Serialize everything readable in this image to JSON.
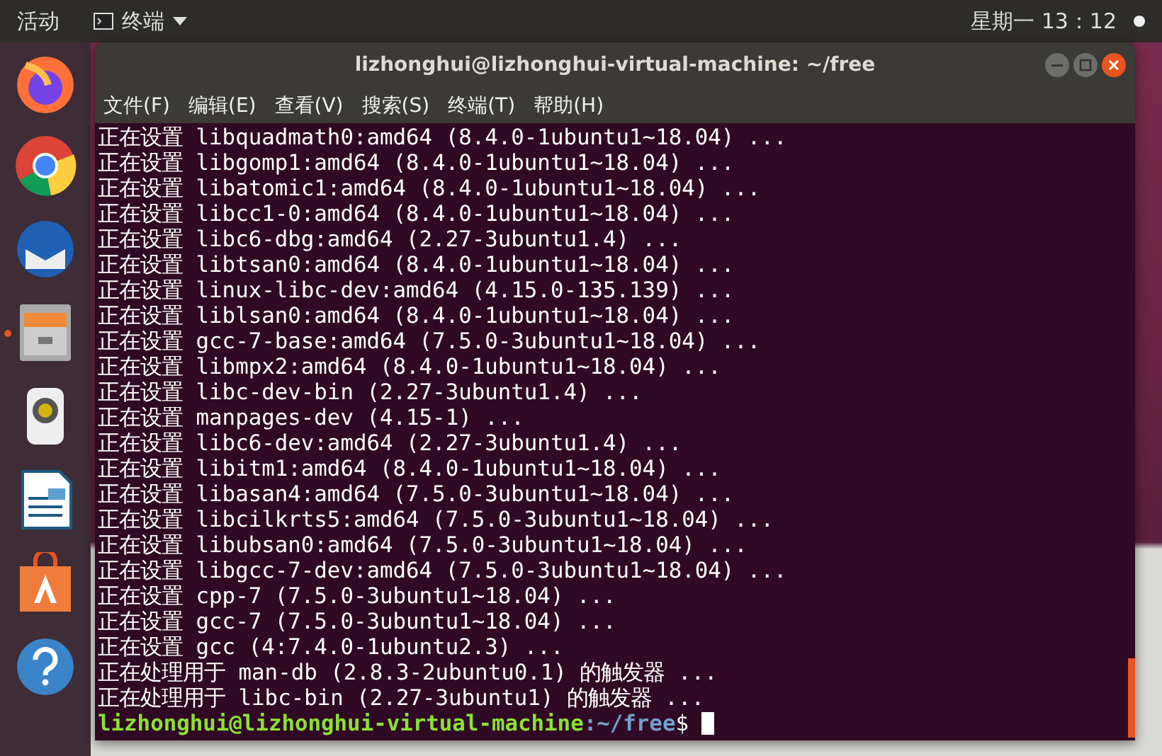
{
  "top_bar": {
    "activities": "活动",
    "app_menu": "终端",
    "clock": "星期一 13：12"
  },
  "dock": {
    "items": [
      {
        "kind": "globe",
        "running": false
      },
      {
        "kind": "chrome",
        "running": false
      },
      {
        "kind": "mail",
        "running": false
      },
      {
        "kind": "cabinet",
        "running": true
      },
      {
        "kind": "speaker",
        "running": false
      },
      {
        "kind": "document",
        "running": false
      },
      {
        "kind": "bag",
        "running": false
      },
      {
        "kind": "help",
        "running": false
      }
    ]
  },
  "window": {
    "title": "lizhonghui@lizhonghui-virtual-machine: ~/free",
    "menu": [
      "文件(F)",
      "编辑(E)",
      "查看(V)",
      "搜索(S)",
      "终端(T)",
      "帮助(H)"
    ],
    "lines": [
      {
        "kind": "output",
        "prefix": "正在设置",
        "text": "libquadmath0:amd64 (8.4.0-1ubuntu1~18.04) ..."
      },
      {
        "kind": "output",
        "prefix": "正在设置",
        "text": "libgomp1:amd64 (8.4.0-1ubuntu1~18.04) ..."
      },
      {
        "kind": "output",
        "prefix": "正在设置",
        "text": "libatomic1:amd64 (8.4.0-1ubuntu1~18.04) ..."
      },
      {
        "kind": "output",
        "prefix": "正在设置",
        "text": "libcc1-0:amd64 (8.4.0-1ubuntu1~18.04) ..."
      },
      {
        "kind": "output",
        "prefix": "正在设置",
        "text": "libc6-dbg:amd64 (2.27-3ubuntu1.4) ..."
      },
      {
        "kind": "output",
        "prefix": "正在设置",
        "text": "libtsan0:amd64 (8.4.0-1ubuntu1~18.04) ..."
      },
      {
        "kind": "output",
        "prefix": "正在设置",
        "text": "linux-libc-dev:amd64 (4.15.0-135.139) ..."
      },
      {
        "kind": "output",
        "prefix": "正在设置",
        "text": "liblsan0:amd64 (8.4.0-1ubuntu1~18.04) ..."
      },
      {
        "kind": "output",
        "prefix": "正在设置",
        "text": "gcc-7-base:amd64 (7.5.0-3ubuntu1~18.04) ..."
      },
      {
        "kind": "output",
        "prefix": "正在设置",
        "text": "libmpx2:amd64 (8.4.0-1ubuntu1~18.04) ..."
      },
      {
        "kind": "output",
        "prefix": "正在设置",
        "text": "libc-dev-bin (2.27-3ubuntu1.4) ..."
      },
      {
        "kind": "output",
        "prefix": "正在设置",
        "text": "manpages-dev (4.15-1) ..."
      },
      {
        "kind": "output",
        "prefix": "正在设置",
        "text": "libc6-dev:amd64 (2.27-3ubuntu1.4) ..."
      },
      {
        "kind": "output",
        "prefix": "正在设置",
        "text": "libitm1:amd64 (8.4.0-1ubuntu1~18.04) ..."
      },
      {
        "kind": "output",
        "prefix": "正在设置",
        "text": "libasan4:amd64 (7.5.0-3ubuntu1~18.04) ..."
      },
      {
        "kind": "output",
        "prefix": "正在设置",
        "text": "libcilkrts5:amd64 (7.5.0-3ubuntu1~18.04) ..."
      },
      {
        "kind": "output",
        "prefix": "正在设置",
        "text": "libubsan0:amd64 (7.5.0-3ubuntu1~18.04) ..."
      },
      {
        "kind": "output",
        "prefix": "正在设置",
        "text": "libgcc-7-dev:amd64 (7.5.0-3ubuntu1~18.04) ..."
      },
      {
        "kind": "output",
        "prefix": "正在设置",
        "text": "cpp-7 (7.5.0-3ubuntu1~18.04) ..."
      },
      {
        "kind": "output",
        "prefix": "正在设置",
        "text": "gcc-7 (7.5.0-3ubuntu1~18.04) ..."
      },
      {
        "kind": "output",
        "prefix": "正在设置",
        "text": "gcc (4:7.4.0-1ubuntu2.3) ..."
      },
      {
        "kind": "output",
        "prefix": "正在处理用于",
        "text": "man-db (2.8.3-2ubuntu0.1) 的触发器 ..."
      },
      {
        "kind": "output",
        "prefix": "正在处理用于",
        "text": "libc-bin (2.27-3ubuntu1) 的触发器 ..."
      },
      {
        "kind": "prompt",
        "user": "lizhonghui@lizhonghui-virtual-machine",
        "path": ":~/free",
        "sign": "$"
      }
    ]
  }
}
